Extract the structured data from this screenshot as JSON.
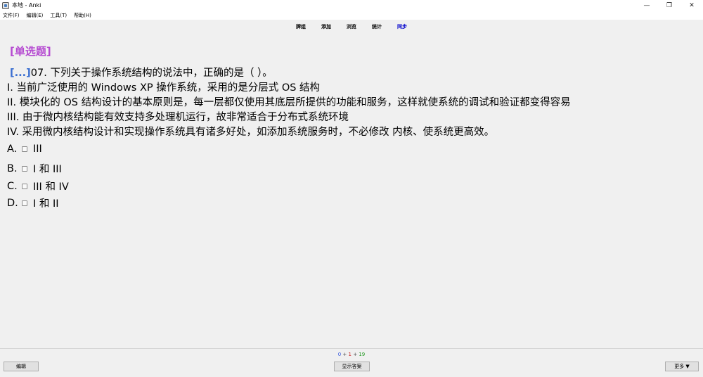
{
  "window": {
    "title": "本地 - Anki",
    "minimize": "—",
    "maximize": "❐",
    "close": "✕"
  },
  "menu": {
    "items": [
      "文件(F)",
      "编辑(E)",
      "工具(T)",
      "帮助(H)"
    ]
  },
  "toolbar": {
    "items": [
      "牌组",
      "添加",
      "浏览",
      "统计",
      "同步"
    ]
  },
  "card": {
    "question_type": "[单选题]",
    "cloze": "[...]",
    "question": "07. 下列关于操作系统结构的说法中，正确的是（ ）。",
    "statements": [
      "I. 当前广泛使用的 Windows XP 操作系统，采用的是分层式 OS 结构",
      "II. 模块化的 OS 结构设计的基本原则是，每一层都仅使用其底层所提供的功能和服务，这样就使系统的调试和验证都变得容易",
      "III. 由于微内核结构能有效支持多处理机运行，故非常适合于分布式系统环境",
      "IV. 采用微内核结构设计和实现操作系统具有诸多好处，如添加系统服务时，不必修改 内核、使系统更高效。"
    ],
    "options": [
      {
        "letter": "A.",
        "text": "III"
      },
      {
        "letter": "B.",
        "text": "I 和 III"
      },
      {
        "letter": "C.",
        "text": "III 和 IV"
      },
      {
        "letter": "D.",
        "text": "I 和 II"
      }
    ]
  },
  "bottom": {
    "counts": {
      "new": "0",
      "learning": "1",
      "review": "19",
      "sep": "+"
    },
    "edit_label": "编辑",
    "show_answer_label": "显示答案",
    "more_label": "更多 ▼"
  },
  "colors": {
    "question_type": "#b54ad1",
    "cloze": "#3b6fd1",
    "sync_link": "#0000cc"
  }
}
